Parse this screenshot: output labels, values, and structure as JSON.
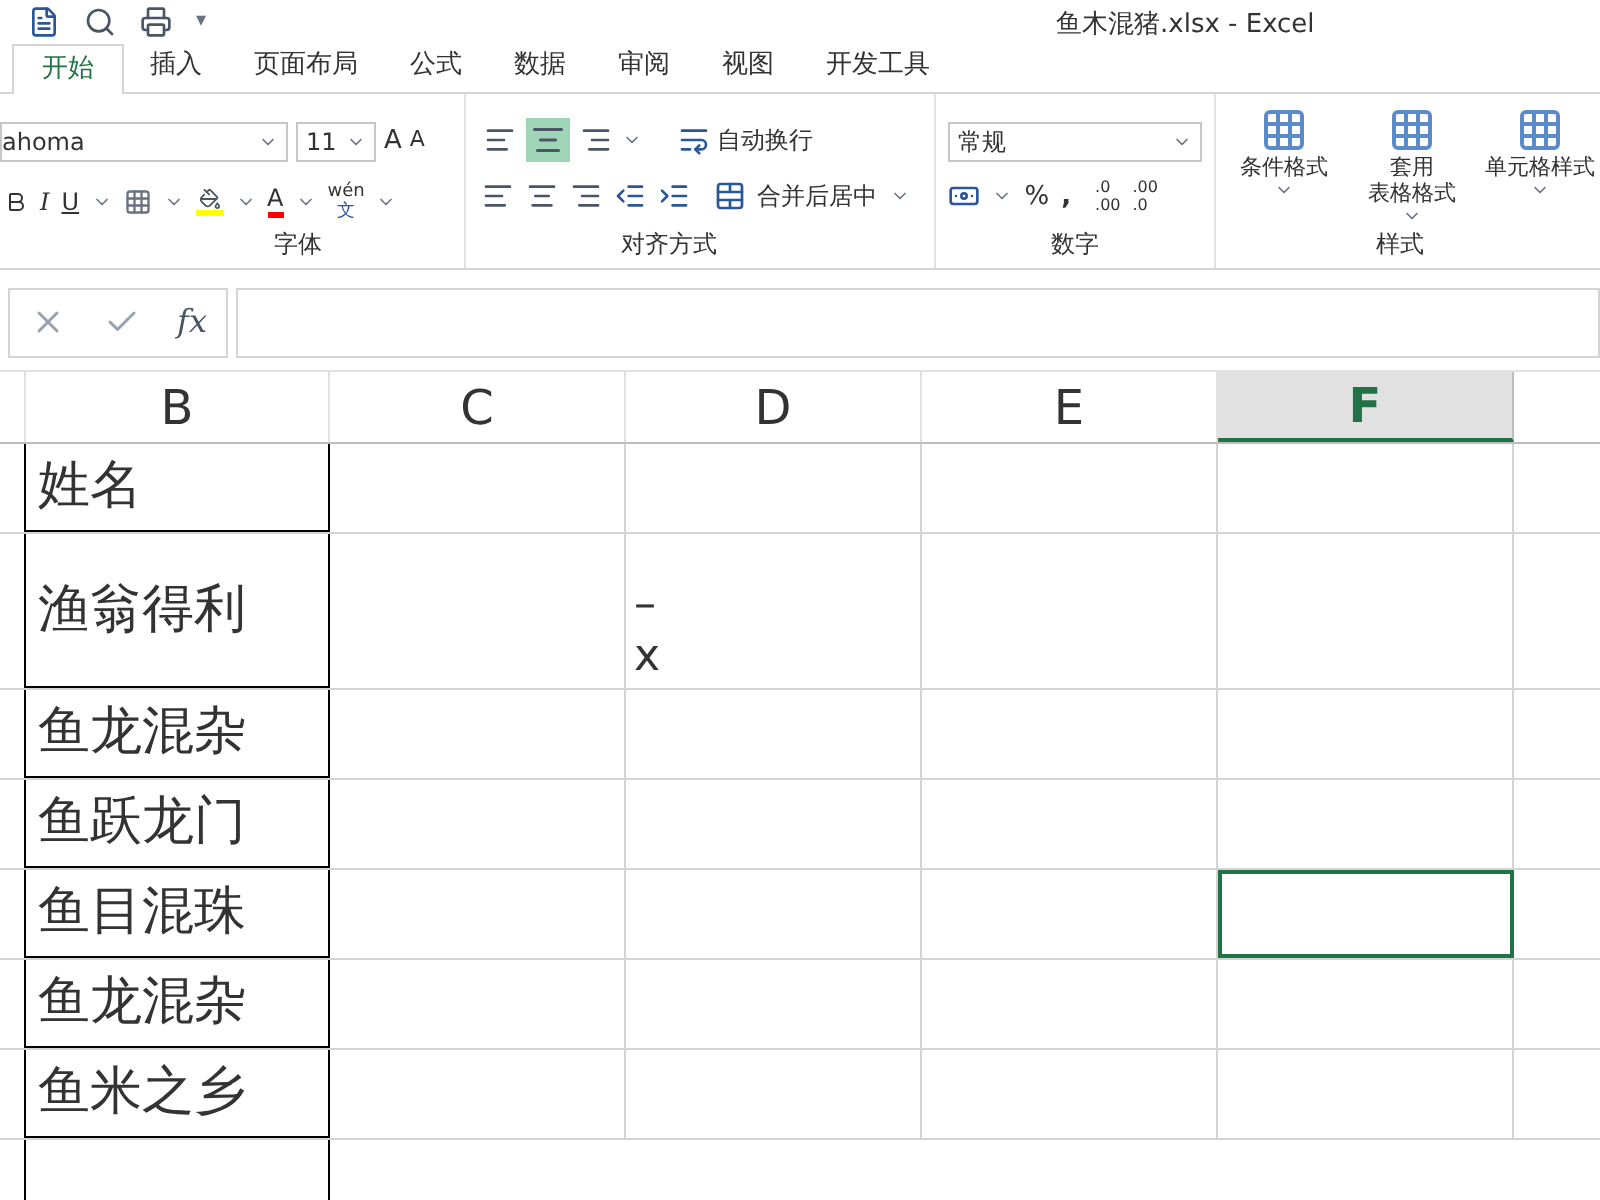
{
  "window": {
    "title": "鱼木混猪.xlsx - Excel"
  },
  "quick_access": {
    "more": "▾"
  },
  "tabs": [
    {
      "label": "开始",
      "selected": true
    },
    {
      "label": "插入",
      "selected": false
    },
    {
      "label": "页面布局",
      "selected": false
    },
    {
      "label": "公式",
      "selected": false
    },
    {
      "label": "数据",
      "selected": false
    },
    {
      "label": "审阅",
      "selected": false
    },
    {
      "label": "视图",
      "selected": false
    },
    {
      "label": "开发工具",
      "selected": false
    }
  ],
  "ribbon": {
    "font": {
      "name": "ahoma",
      "size": "11",
      "italic": "I",
      "underline": "U",
      "grow": "A",
      "shrink": "A",
      "font_color": "A",
      "phonetic_top": "wén",
      "phonetic_bottom": "文",
      "group": "字体"
    },
    "alignment": {
      "middle_align_selected": true,
      "wrap": "自动换行",
      "merge": "合并后居中",
      "group": "对齐方式"
    },
    "number": {
      "format": "常规",
      "percent": "%",
      "comma": ",",
      "decrease_decimal": [
        ".0",
        ".00"
      ],
      "increase_decimal": [
        ".00",
        ".0"
      ],
      "group": "数字"
    },
    "styles": {
      "buttons": [
        {
          "label": "条件格式"
        },
        {
          "label": "套用",
          "second": "表格格式"
        },
        {
          "label": "单元格样式"
        }
      ],
      "group": "样式"
    }
  },
  "formula_bar": {
    "fx": "fx"
  },
  "columns": [
    {
      "label": "B",
      "selected": false
    },
    {
      "label": "C",
      "selected": false
    },
    {
      "label": "D",
      "selected": false
    },
    {
      "label": "E",
      "selected": false
    },
    {
      "label": "F",
      "selected": true
    }
  ],
  "rows": [
    {
      "b": "姓名",
      "d": [],
      "tall": false,
      "selected": false
    },
    {
      "b": "渔翁得利",
      "d": [
        "–",
        "x"
      ],
      "tall": true,
      "selected": false
    },
    {
      "b": "鱼龙混杂",
      "d": [],
      "tall": false,
      "selected": false
    },
    {
      "b": "鱼跃龙门",
      "d": [],
      "tall": false,
      "selected": false
    },
    {
      "b": "鱼目混珠",
      "d": [],
      "tall": false,
      "selected": true
    },
    {
      "b": "鱼龙混杂",
      "d": [],
      "tall": false,
      "selected": false
    },
    {
      "b": "鱼米之乡",
      "d": [],
      "tall": false,
      "selected": false
    }
  ]
}
